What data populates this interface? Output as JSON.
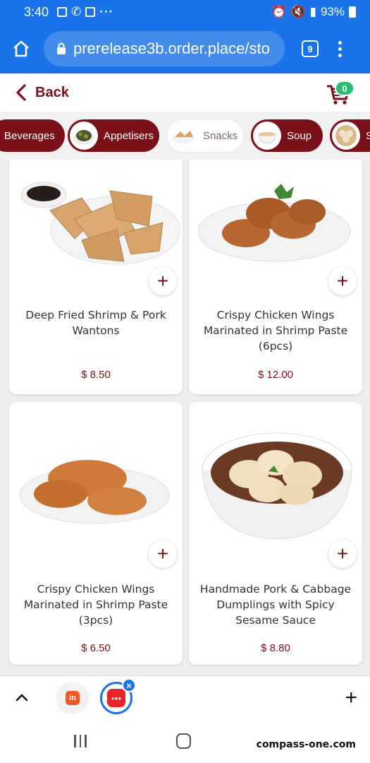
{
  "status_bar": {
    "time": "3:40",
    "battery": "93%"
  },
  "browser": {
    "url": "prerelease3b.order.place/sto",
    "tab_count": "9"
  },
  "header": {
    "back_label": "Back",
    "cart_count": "0"
  },
  "categories": [
    {
      "label": "Beverages",
      "selected": false
    },
    {
      "label": "Appetisers",
      "selected": false
    },
    {
      "label": "Snacks",
      "selected": true
    },
    {
      "label": "Soup",
      "selected": false
    },
    {
      "label": "S",
      "selected": false
    }
  ],
  "products": [
    {
      "name": "Deep Fried Shrimp & Pork Wantons",
      "price": "$ 8.50",
      "add_label": "+"
    },
    {
      "name": "Crispy Chicken Wings Marinated in Shrimp Paste (6pcs)",
      "price": "$ 12.00",
      "add_label": "+"
    },
    {
      "name": "Crispy Chicken Wings Marinated in Shrimp Paste (3pcs)",
      "price": "$ 6.50",
      "add_label": "+"
    },
    {
      "name": "Handmade Pork & Cabbage Dumplings with Spicy Sesame Sauce",
      "price": "$ 8.80",
      "add_label": "+"
    }
  ],
  "bottom_bar": {
    "plus_label": "+"
  },
  "watermark": "compass-one.com",
  "colors": {
    "brand": "#7a1018",
    "chrome": "#1a73e8",
    "badge": "#2bbd6e"
  }
}
